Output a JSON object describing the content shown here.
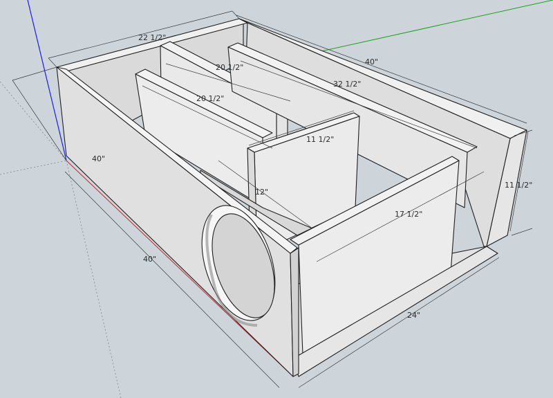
{
  "dimensions": {
    "top_width": "22 1/2\"",
    "back_length": "40\"",
    "divider_back": "20 1/2\"",
    "divider_mid": "20 1/2\"",
    "port_length": "32 1/2\"",
    "inner_width": "11 1/2\"",
    "height": "11 1/2\"",
    "side_length": "40\"",
    "bottom_length": "40\"",
    "panel_height": "12\"",
    "front_length": "17 1/2\"",
    "front_width": "24\""
  },
  "colors": {
    "background": "#cdd5db",
    "panel_light": "#efefef",
    "panel_mid": "#e3e3e3",
    "panel_dark": "#d4d4d4",
    "axis_blue": "#1a1aff",
    "axis_green": "#1aa01a",
    "axis_red": "#cc2222"
  }
}
